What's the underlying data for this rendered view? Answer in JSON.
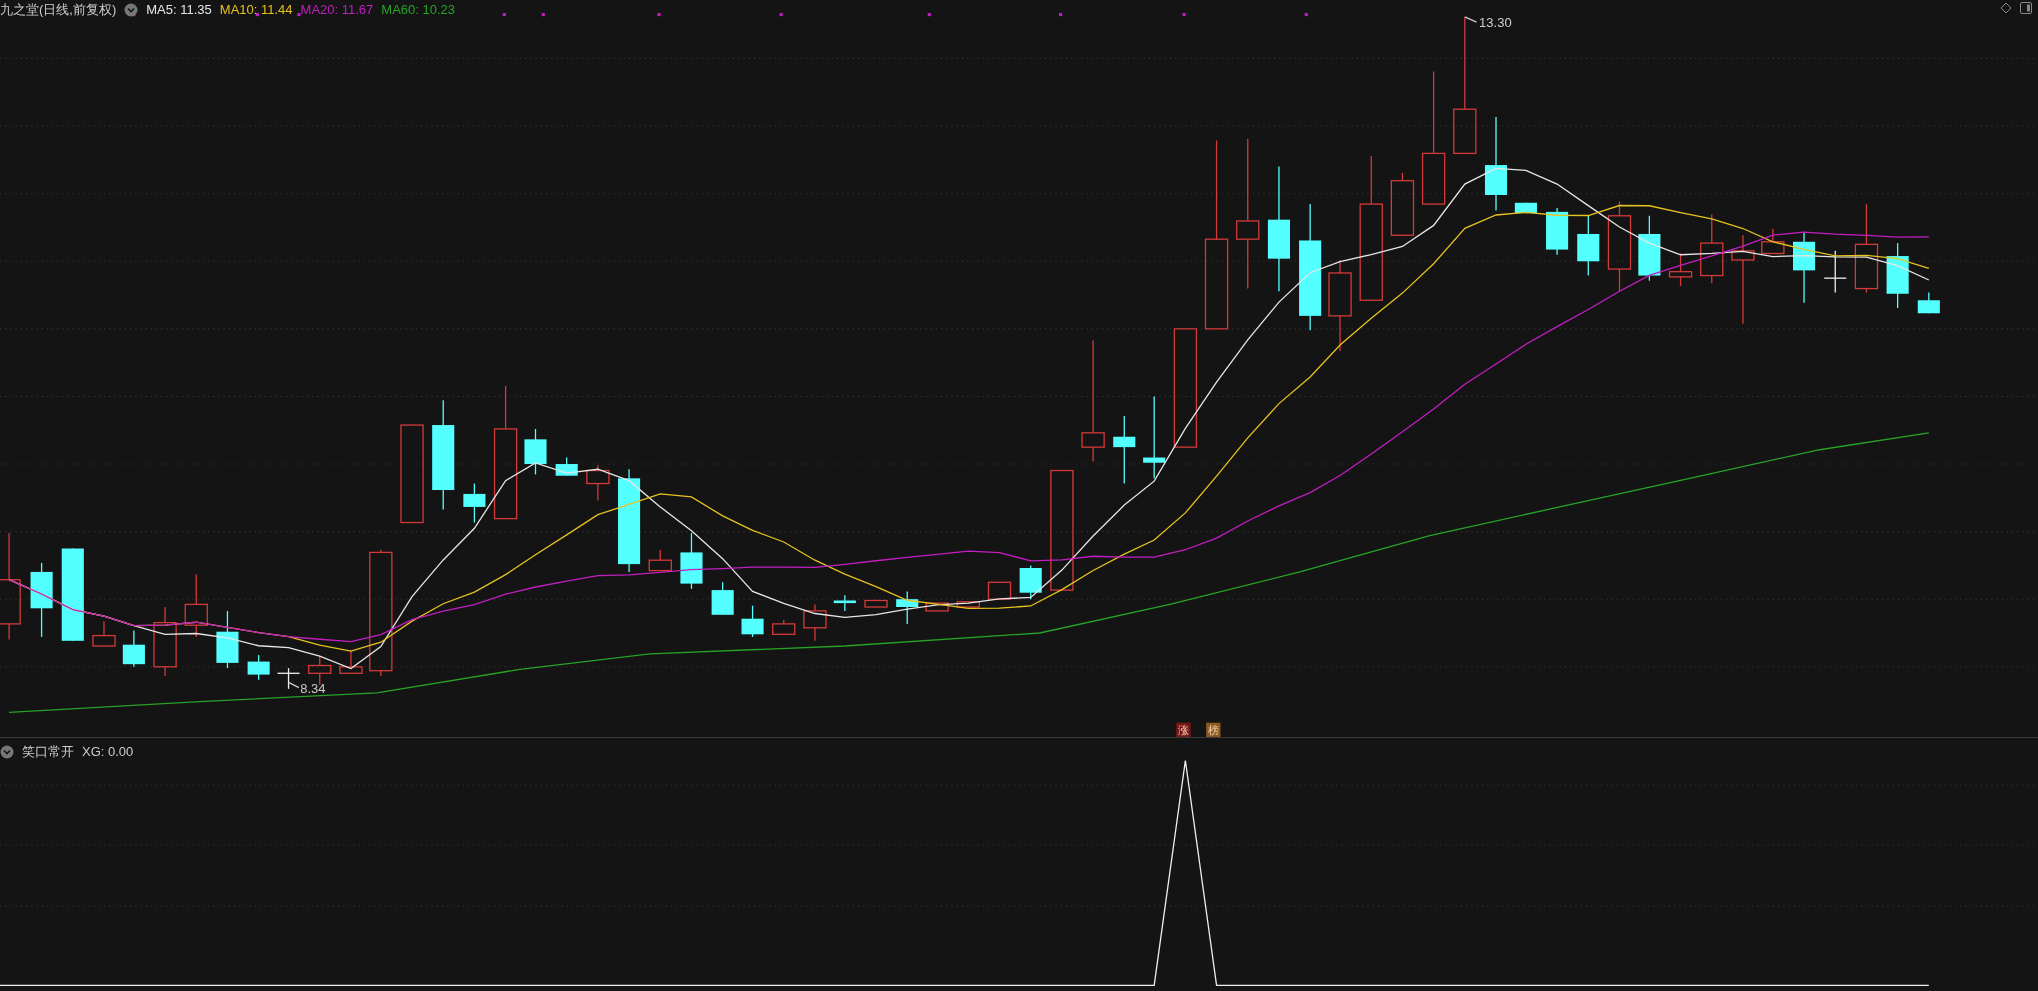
{
  "header": {
    "title": "九之堂(日线,前复权)",
    "indicators": [
      {
        "label": "MA5: 11.35",
        "color": "#e6e6e6"
      },
      {
        "label": "MA10: 11.44",
        "color": "#e6c21e"
      },
      {
        "label": "MA20: 11.67",
        "color": "#c21ec2"
      },
      {
        "label": "MA60: 10.23",
        "color": "#27a327"
      }
    ]
  },
  "high_label": "13.30",
  "low_label": "8.34",
  "signal_badges": [
    {
      "text": "涨",
      "color": "#7a1818"
    },
    {
      "text": "榜",
      "color": "#8a5a1e"
    }
  ],
  "indicator_pane": {
    "title": "笑口常开",
    "reading": "XG: 0.00"
  }
}
